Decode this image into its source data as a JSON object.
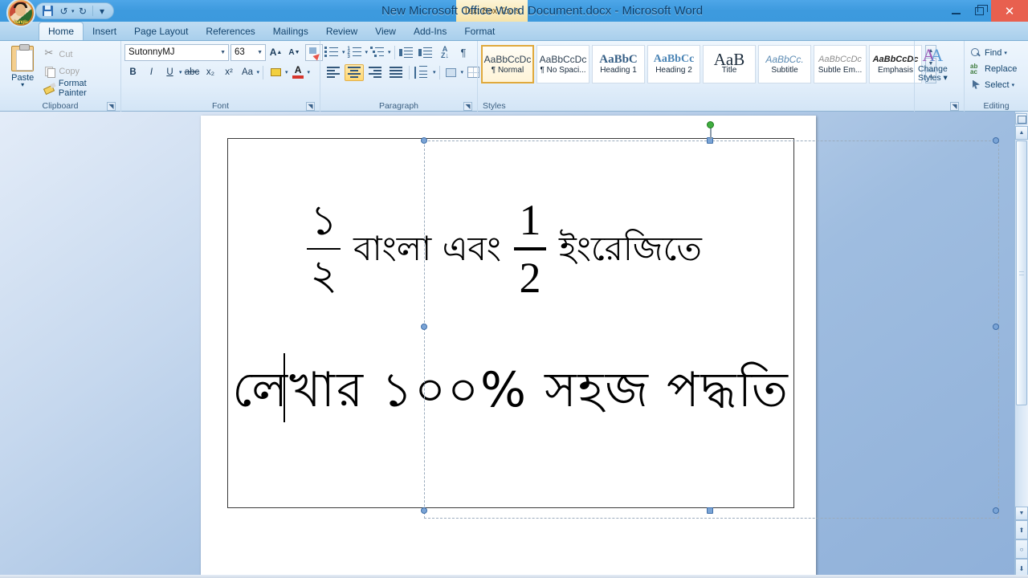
{
  "titlebar": {
    "context_tab": "Text Box Tools",
    "document_title": "New Microsoft Office Word Document.docx - Microsoft Word",
    "quick_access": [
      {
        "name": "save",
        "label": "Save"
      },
      {
        "name": "undo",
        "label": "↺"
      },
      {
        "name": "redo",
        "label": "↻"
      },
      {
        "name": "customize",
        "label": "▾"
      }
    ],
    "window_buttons": {
      "minimize": "Minimize",
      "restore": "Restore Down",
      "close": "✕"
    },
    "accent_blue": "#3d9ade",
    "close_red": "#e8604f"
  },
  "tabs": [
    {
      "label": "Home",
      "active": true
    },
    {
      "label": "Insert",
      "active": false
    },
    {
      "label": "Page Layout",
      "active": false
    },
    {
      "label": "References",
      "active": false
    },
    {
      "label": "Mailings",
      "active": false
    },
    {
      "label": "Review",
      "active": false
    },
    {
      "label": "View",
      "active": false
    },
    {
      "label": "Add-Ins",
      "active": false
    },
    {
      "label": "Format",
      "active": false
    }
  ],
  "ribbon": {
    "clipboard": {
      "label": "Clipboard",
      "paste": "Paste",
      "paste_caret": "▾",
      "cut": "Cut",
      "copy": "Copy",
      "format_painter": "Format Painter"
    },
    "font": {
      "label": "Font",
      "font_name": "SutonnyMJ",
      "font_size": "63",
      "grow_font": "A",
      "shrink_font": "A",
      "clear_formatting": "Clear Formatting",
      "bold": "B",
      "italic": "I",
      "underline": "U",
      "strikethrough": "abc",
      "subscript": "x₂",
      "superscript": "x²",
      "change_case": "Aa",
      "highlight": "Text Highlight Color",
      "font_color": "A",
      "font_color_hex": "#d6342b",
      "highlight_hex": "#f2d040"
    },
    "paragraph": {
      "label": "Paragraph",
      "bullets": "Bullets",
      "numbering": "Numbering",
      "multilevel": "Multilevel List",
      "decrease_indent": "Decrease Indent",
      "increase_indent": "Increase Indent",
      "sort": "Sort",
      "show_marks": "¶",
      "align_left": "Align Left",
      "align_center": "Center",
      "align_right": "Align Right",
      "justify": "Justify",
      "line_spacing": "Line Spacing",
      "shading": "Shading",
      "borders": "Borders",
      "active_alignment": "Center"
    },
    "styles": {
      "label": "Styles",
      "items": [
        {
          "preview": "AaBbCcDc",
          "name": "¶ Normal",
          "selected": true,
          "cls": ""
        },
        {
          "preview": "AaBbCcDc",
          "name": "¶ No Spaci...",
          "selected": false,
          "cls": ""
        },
        {
          "preview": "AaBbC",
          "name": "Heading 1",
          "selected": false,
          "cls": "h1"
        },
        {
          "preview": "AaBbCc",
          "name": "Heading 2",
          "selected": false,
          "cls": "h2"
        },
        {
          "preview": "AaB",
          "name": "Title",
          "selected": false,
          "cls": "title"
        },
        {
          "preview": "AaBbCc.",
          "name": "Subtitle",
          "selected": false,
          "cls": "sub"
        },
        {
          "preview": "AaBbCcDc",
          "name": "Subtle Em...",
          "selected": false,
          "cls": "subem"
        },
        {
          "preview": "AaBbCcDc",
          "name": "Emphasis",
          "selected": false,
          "cls": "em"
        }
      ],
      "scroll_up": "▲",
      "scroll_down": "▼",
      "more": "≡"
    },
    "change_styles": {
      "line1": "Change",
      "line2": "Styles ▾",
      "icon_label": "AA"
    },
    "editing": {
      "label": "Editing",
      "find": "Find",
      "find_caret": "▾",
      "replace": "Replace",
      "select": "Select",
      "select_caret": "▾"
    }
  },
  "document": {
    "line1": {
      "bengali_fraction": {
        "numerator": "১",
        "denominator": "২"
      },
      "bengali_words": "বাংলা এবং",
      "english_fraction": {
        "numerator": "1",
        "denominator": "2"
      },
      "bengali_suffix": "ইংরেজিতে"
    },
    "line2": "লেখার ১০০% সহজ পদ্ধতি",
    "textbox_selected": true,
    "caret_visible": true
  },
  "scrollbar": {
    "scroll_up": "▲",
    "scroll_down": "▼",
    "previous_page": "⬆",
    "select_browse_object": "○",
    "next_page": "⬇",
    "ruler_toggle": "View Ruler"
  }
}
